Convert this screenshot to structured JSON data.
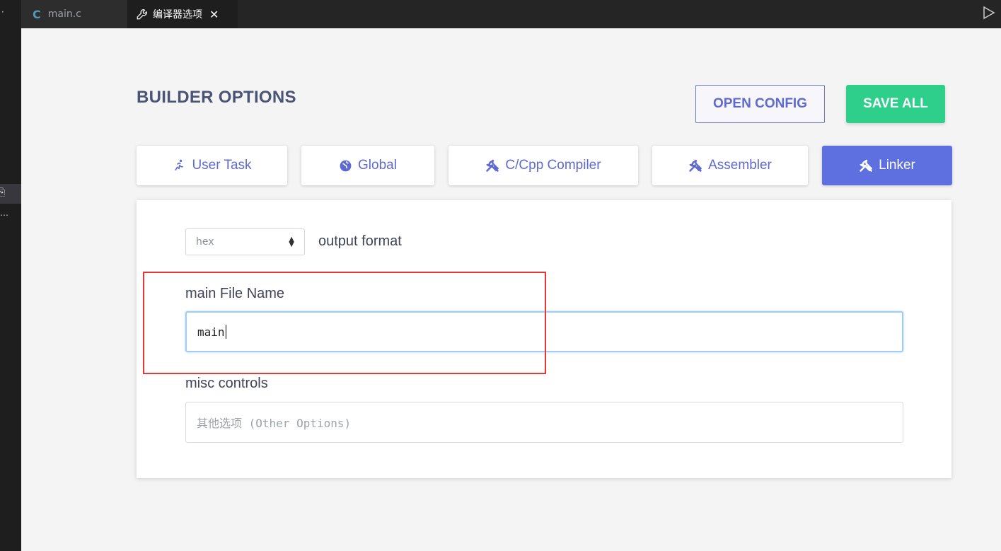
{
  "tabs": {
    "file_tab": {
      "icon": "C",
      "label": "main.c"
    },
    "options_tab": {
      "label": "编译器选项",
      "close": "✕"
    }
  },
  "header": {
    "title": "BUILDER OPTIONS",
    "open_config": "OPEN CONFIG",
    "save_all": "SAVE ALL"
  },
  "nav": {
    "items": [
      {
        "label": "User Task",
        "icon": "running-figure-icon"
      },
      {
        "label": "Global",
        "icon": "globe-icon"
      },
      {
        "label": "C/Cpp Compiler",
        "icon": "tools-icon"
      },
      {
        "label": "Assembler",
        "icon": "tools-icon"
      },
      {
        "label": "Linker",
        "icon": "tools-icon",
        "active": true
      }
    ]
  },
  "form": {
    "output_format": {
      "value": "hex",
      "label": "output format"
    },
    "main_file": {
      "label": "main File Name",
      "value": "main"
    },
    "misc": {
      "label": "misc controls",
      "placeholder": "其他选项 (Other Options)"
    }
  },
  "colors": {
    "accent": "#5e6fe0",
    "save": "#2ecf8a",
    "highlight": "#e53935"
  }
}
